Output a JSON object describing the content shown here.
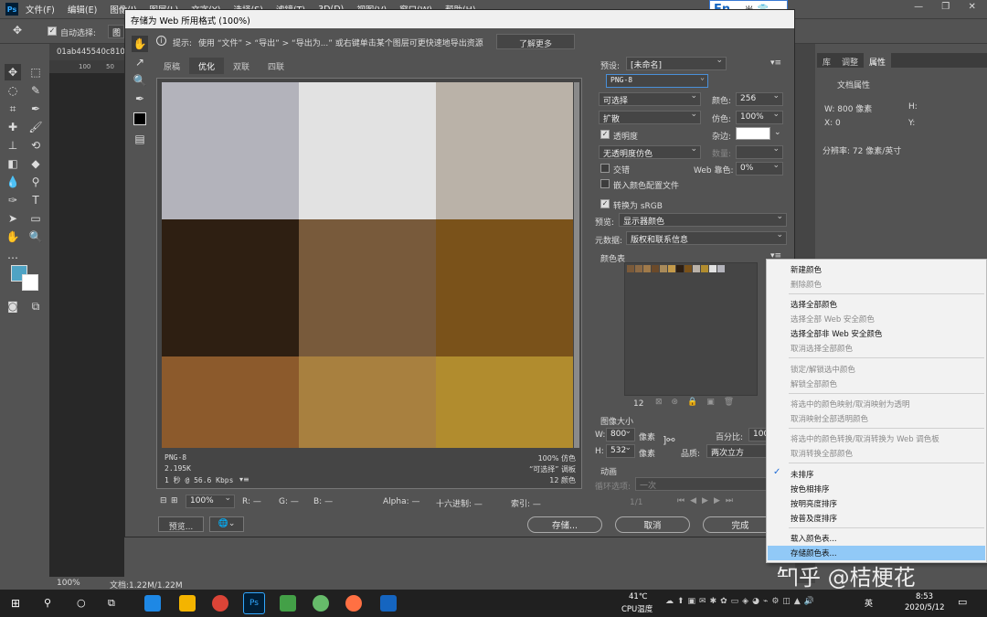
{
  "menu": {
    "logo": "Ps",
    "items": [
      "文件(F)",
      "编辑(E)",
      "图像(I)",
      "图层(L)",
      "文字(Y)",
      "选择(S)",
      "滤镜(T)",
      "3D(D)",
      "视图(V)",
      "窗口(W)",
      "帮助(H)"
    ]
  },
  "ime": {
    "label": "En",
    "extra": "·, 半"
  },
  "options": {
    "auto_select": "自动选择:",
    "auto_select_value": "图层"
  },
  "doc_tab": {
    "name": "01ab445540c810"
  },
  "ruler_ticks": [
    "100",
    "50"
  ],
  "dialog": {
    "title": "存储为 Web 所用格式 (100%)",
    "hint_prefix": "提示:",
    "hint": "使用 “文件” > “导出” > “导出为...” 或右键单击某个图层可更快速地导出资源",
    "learn_more": "了解更多",
    "tabs": [
      "原稿",
      "优化",
      "双联",
      "四联"
    ],
    "swatch_colors": [
      "#b3b3bb",
      "#e2e2e2",
      "#bab2a8",
      "#2e1f12",
      "#785a3b",
      "#7a521a",
      "#8c5a2c",
      "#a8803f",
      "#b18c2e"
    ],
    "info_left": [
      "PNG-8",
      "2.195K",
      "1 秒 @ 56.6 Kbps"
    ],
    "info_right": [
      "100% 仿色",
      "“可选择” 调板",
      "12 颜色"
    ],
    "bottom_bar": {
      "zoom": "100%",
      "r": "R: —",
      "g": "G: —",
      "b": "B: —",
      "alpha": "Alpha: —",
      "hex": "十六进制: —",
      "index": "索引: —"
    },
    "preview_btn": "预览...",
    "save_btn": "存储...",
    "cancel_btn": "取消",
    "done_btn": "完成",
    "preset_label": "预设:",
    "preset_value": "[未命名]",
    "format": "PNG-8",
    "reduction": "可选择",
    "colors_label": "颜色:",
    "colors_value": "256",
    "dither_algo": "扩散",
    "dither_label": "仿色:",
    "dither_value": "100%",
    "transparency": "透明度",
    "matte_label": "杂边:",
    "trans_dither": "无透明度仿色",
    "amount_label": "数量:",
    "interlaced": "交错",
    "web_snap_label": "Web 靠色:",
    "web_snap_value": "0%",
    "embed_profile": "嵌入颜色配置文件",
    "convert_srgb": "转换为 sRGB",
    "preview_label": "预览:",
    "preview_value": "显示器颜色",
    "metadata_label": "元数据:",
    "metadata_value": "版权和联系信息",
    "color_table_label": "颜色表",
    "table_colors": [
      "#7a5a3a",
      "#8c6a45",
      "#a07a4a",
      "#6b4a2a",
      "#a88a5a",
      "#c49a4a",
      "#2e1f12",
      "#7a521a",
      "#bab2a8",
      "#b18c2e",
      "#e2e2e2",
      "#b3b3bb"
    ],
    "color_count": "12",
    "image_size_label": "图像大小",
    "w_label": "W:",
    "w_value": "800",
    "h_label": "H:",
    "h_value": "532",
    "px": "像素",
    "percent_label": "百分比:",
    "percent_value": "100",
    "quality_label": "品质:",
    "quality_value": "两次立方",
    "anim_label": "动画",
    "loop_label": "循环选项:",
    "loop_value": "一次",
    "frame": "1/1"
  },
  "context_menu": {
    "items": [
      {
        "label": "新建颜色",
        "disabled": false
      },
      {
        "label": "删除颜色",
        "disabled": true
      },
      {
        "label": "选择全部颜色",
        "disabled": false
      },
      {
        "label": "选择全部 Web 安全颜色",
        "disabled": true
      },
      {
        "label": "选择全部非 Web 安全颜色",
        "disabled": false
      },
      {
        "label": "取消选择全部颜色",
        "disabled": true
      },
      {
        "label": "锁定/解锁选中颜色",
        "disabled": true
      },
      {
        "label": "解锁全部颜色",
        "disabled": true
      },
      {
        "label": "将选中的颜色映射/取消映射为透明",
        "disabled": true
      },
      {
        "label": "取消映射全部透明颜色",
        "disabled": true
      },
      {
        "label": "将选中的颜色转换/取消转换为 Web 调色板",
        "disabled": true
      },
      {
        "label": "取消转换全部颜色",
        "disabled": true
      },
      {
        "label": "未排序",
        "disabled": false,
        "checked": true
      },
      {
        "label": "按色相排序",
        "disabled": false
      },
      {
        "label": "按明亮度排序",
        "disabled": false
      },
      {
        "label": "按普及度排序",
        "disabled": false
      },
      {
        "label": "载入颜色表...",
        "disabled": false
      },
      {
        "label": "存储颜色表...",
        "disabled": false,
        "highlighted": true
      }
    ]
  },
  "right_panel": {
    "tabs": [
      "库",
      "调整",
      "属性"
    ],
    "doc_props": "文档属性",
    "w": "W: 800 像素",
    "h": "H:",
    "x": "X: 0",
    "y": "Y:",
    "resolution": "分辨率: 72 像素/英寸"
  },
  "status": {
    "zoom": "100%",
    "doc": "文档:1.22M/1.22M"
  },
  "watermark": "知乎 @桔梗花",
  "taskbar": {
    "temp": "41℃",
    "temp_label": "CPU温度",
    "lang": "英",
    "time": "8:53",
    "date": "2020/5/12"
  }
}
